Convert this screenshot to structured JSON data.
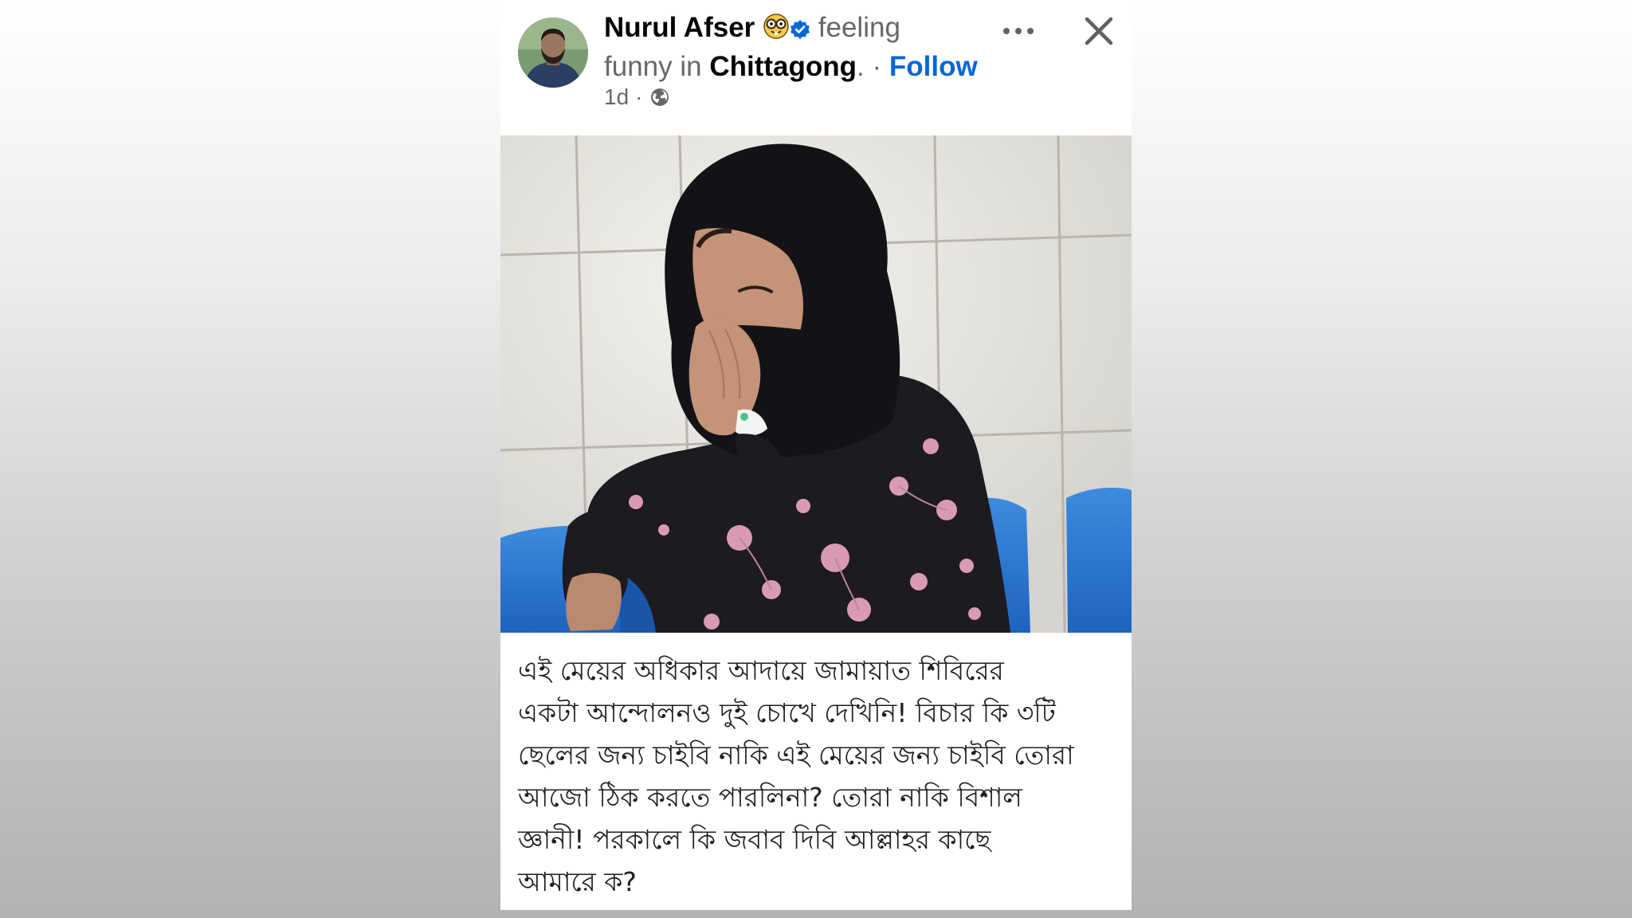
{
  "post": {
    "author": "Nurul Afser",
    "emoji_icon": "nerd-face-icon",
    "verified_icon": "verified-badge-icon",
    "feeling_word": "feeling",
    "feeling_rest": "funny in",
    "location": "Chittagong",
    "separator": "·",
    "follow_label": "Follow",
    "time": "1d",
    "time_separator": "·",
    "privacy_icon": "globe-icon",
    "more_icon": "more-horizontal-icon",
    "close_icon": "close-icon",
    "accent_color": "#0866d6",
    "caption_lines": [
      "এই মেয়ের অধিকার আদায়ে জামায়াত শিবিরের",
      "একটা আন্দোলনও দুই চোখে দেখিনি! বিচার কি ৩টি",
      "ছেলের জন্য চাইবি নাকি এই মেয়ের জন্য চাইবি তোরা",
      "আজো ঠিক করতে পারলিনা? তোরা নাকি বিশাল",
      "জ্ঞানী! পরকালে কি জবাব দিবি আল্লাহর কাছে",
      "আমারে ক?"
    ]
  }
}
